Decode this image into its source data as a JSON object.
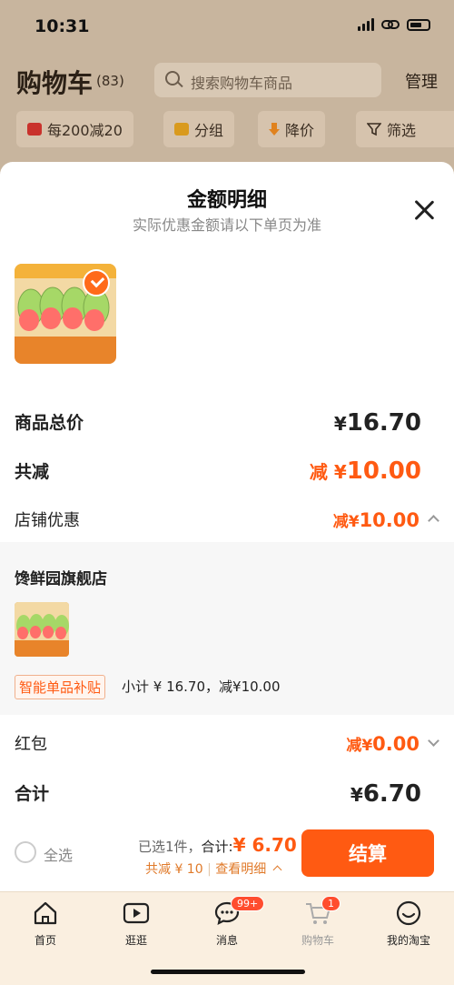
{
  "status_bar": {
    "time": "10:31"
  },
  "cart_header": {
    "title": "购物车",
    "count": "(83)",
    "search_placeholder": "搜索购物车商品",
    "manage": "管理"
  },
  "filter_chips": [
    {
      "label": "每200减20",
      "icon": "store-coupon-icon"
    },
    {
      "label": "分组",
      "icon": "folder-icon"
    },
    {
      "label": "降价",
      "icon": "price-drop-icon"
    },
    {
      "label": "筛选",
      "icon": "filter-icon"
    }
  ],
  "sheet": {
    "title": "金额明细",
    "subtitle": "实际优惠金额请以下单页为准",
    "rows": {
      "goods_total_label": "商品总价",
      "goods_total_value": "16.70",
      "total_reduce_label": "共减",
      "total_reduce_value": "10.00",
      "shop_discount_label": "店铺优惠",
      "shop_discount_value": "10.00",
      "red_packet_label": "红包",
      "red_packet_value": "0.00",
      "sum_label": "合计",
      "sum_value": "6.70"
    },
    "currency": "¥",
    "reduce_prefix": "减",
    "shop": {
      "name": "馋鲜园旗舰店",
      "tag": "智能单品补贴",
      "subtotal": "小计 ¥ 16.70，减¥10.00"
    }
  },
  "checkout": {
    "select_all": "全选",
    "selected_prefix": "已选1件，",
    "total_label": "合计:",
    "total_amount": "¥ 6.70",
    "discount_text": "共减 ¥ 10",
    "details_link": "查看明细",
    "settle_button": "结算"
  },
  "tabbar": {
    "items": [
      {
        "label": "首页",
        "icon": "home-icon"
      },
      {
        "label": "逛逛",
        "icon": "play-icon"
      },
      {
        "label": "消息",
        "icon": "message-icon",
        "badge": "99+"
      },
      {
        "label": "购物车",
        "icon": "cart-icon",
        "badge": "1"
      },
      {
        "label": "我的淘宝",
        "icon": "smile-icon"
      }
    ]
  },
  "colors": {
    "accent": "#ff5a12",
    "sheet_bg": "#ffffff",
    "tabbar_bg": "#faefe0"
  }
}
